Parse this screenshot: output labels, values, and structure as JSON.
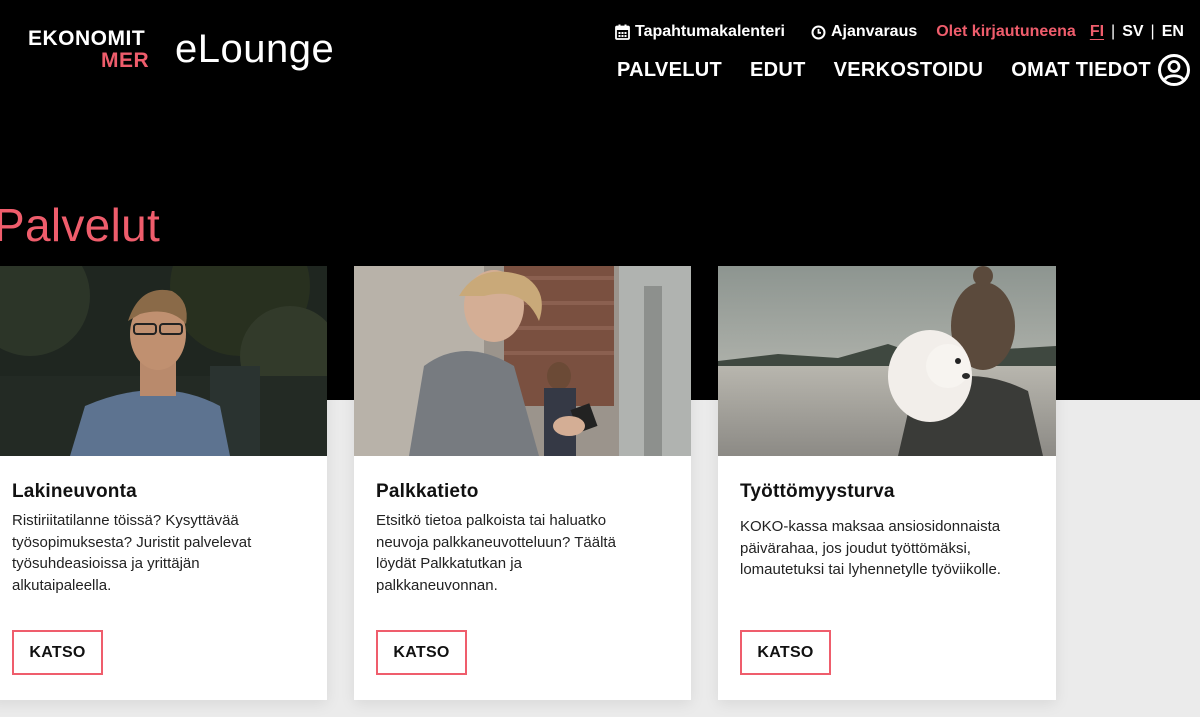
{
  "header": {
    "logo_line1": "EKONOMIT",
    "logo_line2": "MER",
    "site_name": "eLounge",
    "utility": {
      "calendar_label": "Tapahtumakalenteri",
      "booking_label": "Ajanvaraus",
      "login_status": "Olet kirjautuneena",
      "lang_fi": "FI",
      "lang_sv": "SV",
      "lang_en": "EN",
      "separator": "|"
    },
    "nav": [
      "PALVELUT",
      "EDUT",
      "VERKOSTOIDU",
      "OMAT TIEDOT"
    ]
  },
  "page": {
    "title": "Palvelut"
  },
  "cards": [
    {
      "title": "Lakineuvonta",
      "text": "Ristiriitatilanne töissä? Kysyttävää työsopimuksesta? Juristit palvelevat työsuhdeasioissa ja yrittäjän alkutaipaleella.",
      "button": "KATSO"
    },
    {
      "title": "Palkkatieto",
      "text": "Etsitkö tietoa palkoista tai haluatko neuvoja palkkaneuvotteluun? Täältä löydät Palkkatutkan ja palkkaneuvonnan.",
      "button": "KATSO"
    },
    {
      "title": "Työttömyysturva",
      "text": "KOKO-kassa maksaa ansiosidonnaista päivärahaa, jos joudut työttömäksi, lomautetuksi tai lyhennetylle työviikolle.",
      "button": "KATSO"
    }
  ],
  "colors": {
    "accent": "#ef5d6c",
    "header_bg": "#000000",
    "page_bg": "#ebebeb"
  },
  "icons": [
    "calendar-icon",
    "clock-icon",
    "user-account-icon"
  ]
}
